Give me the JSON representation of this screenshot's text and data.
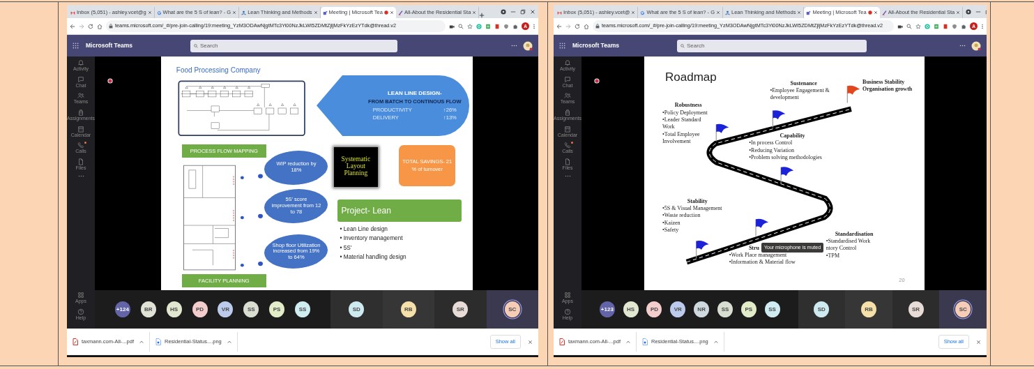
{
  "screenshots": [
    {
      "browser": {
        "tabs": [
          {
            "title": "Inbox (5,051) - ashley.vcet@g",
            "selected": false,
            "recording": false
          },
          {
            "title": "What are the 5 S of lean? - G",
            "selected": false,
            "recording": false
          },
          {
            "title": "Lean Thinking and Methods",
            "selected": false,
            "recording": false
          },
          {
            "title": "Meeting | Microsoft Tea",
            "selected": true,
            "recording": true
          },
          {
            "title": "All-About the Residential Sta",
            "selected": false,
            "recording": false
          }
        ],
        "url": "teams.microsoft.com/_#/pre-join-calling/19:meeting_YzM3ODAwNjgtMTc3Yi00NzJkLWI5ZDMtZjljMzFkYzEzYTdk@thread.v2",
        "profile_initial": "A"
      },
      "teams": {
        "app_title": "Microsoft Teams",
        "search": {
          "placeholder": "Search"
        },
        "rail": [
          {
            "label": "Activity",
            "badge": false
          },
          {
            "label": "Chat",
            "badge": false
          },
          {
            "label": "Teams",
            "badge": false
          },
          {
            "label": "Assignments",
            "badge": false
          },
          {
            "label": "Calendar",
            "badge": false
          },
          {
            "label": "Calls",
            "badge": true
          },
          {
            "label": "Files",
            "badge": false
          }
        ],
        "rail_bottom": [
          {
            "label": "Apps"
          },
          {
            "label": "Help"
          }
        ]
      },
      "slide": {
        "kind": "lean",
        "title": "Food Processing Company",
        "banners": [
          "PROCESS FLOW MAPPING",
          "FACILITY PLANNING"
        ],
        "arrow": {
          "heading": "LEAN LINE DESIGN-",
          "subheading": "FROM BATCH TO CONTINOUS FLOW",
          "metrics": [
            {
              "label": "PRODUCTIVITY",
              "value": "↑26%"
            },
            {
              "label": "DELIVERY",
              "value": "↑13%"
            }
          ]
        },
        "clouds": [
          "WIP reduction by 18%",
          "5S’ score improvement from 12 to 78",
          "Shop floor Utilization increased from 19% to 64%"
        ],
        "method_box": "Systematic Layout Planning",
        "savings": "TOTAL SAVINGS- 21 % of turnover",
        "project": {
          "title": "Project- Lean",
          "items": [
            "• Lean Line design",
            "• Inventory management",
            "• 5S’",
            "• Material handling design"
          ]
        }
      },
      "participants": [
        {
          "initials": "+124",
          "kind": "overflow",
          "color": "#6264a7",
          "speaking": false
        },
        {
          "initials": "BR",
          "kind": "avatar",
          "color": "#dfe3d6",
          "speaking": false
        },
        {
          "initials": "HS",
          "kind": "avatar",
          "color": "#e0e9cf",
          "speaking": false
        },
        {
          "initials": "PD",
          "kind": "avatar",
          "color": "#f3cccc",
          "speaking": false
        },
        {
          "initials": "VR",
          "kind": "avatar",
          "color": "#bccbec",
          "speaking": false
        },
        {
          "initials": "SS",
          "kind": "avatar",
          "color": "#d9dfd0",
          "speaking": false
        },
        {
          "initials": "PS",
          "kind": "avatar",
          "color": "#e3ecc8",
          "speaking": false
        },
        {
          "initials": "SS",
          "kind": "avatar",
          "color": "#cfecf1",
          "speaking": false
        },
        {
          "initials": "SD",
          "kind": "tile",
          "color": "#cdeaf0",
          "speaking": false
        },
        {
          "initials": "RB",
          "kind": "tile",
          "color": "#f6e0a9",
          "speaking": false
        },
        {
          "initials": "SR",
          "kind": "tile",
          "color": "#e8dcd6",
          "speaking": false
        },
        {
          "initials": "SC",
          "kind": "tile",
          "color": "#f5cdb7",
          "speaking": true
        }
      ],
      "downloads": {
        "files": [
          {
            "name": "taxmann.com-All-...pdf",
            "kind": "pdf"
          },
          {
            "name": "Residential-Status....png",
            "kind": "image"
          }
        ],
        "show_all": "Show all"
      }
    },
    {
      "browser": {
        "tabs": [
          {
            "title": "Inbox (5,051) - ashley.vcet@",
            "selected": false,
            "recording": false
          },
          {
            "title": "What are the 5 S of lean? - G",
            "selected": false,
            "recording": false
          },
          {
            "title": "Lean Thinking and Methods",
            "selected": false,
            "recording": false
          },
          {
            "title": "Meeting | Microsoft Tea",
            "selected": true,
            "recording": true
          },
          {
            "title": "All-About the Residential Sta",
            "selected": false,
            "recording": false
          }
        ],
        "url": "teams.microsoft.com/_#/pre-join-calling/19:meeting_YzM3ODAwNjgtMTc3Yi00NzJkLWI5ZDMtZjljMzFkYzEzYTdk@thread.v2",
        "profile_initial": "A"
      },
      "teams": {
        "app_title": "Microsoft Teams",
        "search": {
          "placeholder": "Search"
        },
        "rail": [
          {
            "label": "Activity",
            "badge": false
          },
          {
            "label": "Chat",
            "badge": false
          },
          {
            "label": "Teams",
            "badge": false
          },
          {
            "label": "Assignments",
            "badge": false
          },
          {
            "label": "Calendar",
            "badge": false
          },
          {
            "label": "Calls",
            "badge": true
          },
          {
            "label": "Files",
            "badge": false
          }
        ],
        "rail_bottom": [
          {
            "label": "Apps"
          },
          {
            "label": "Help"
          }
        ],
        "toast": "Your microphone is muted"
      },
      "slide": {
        "kind": "roadmap",
        "title": "Roadmap",
        "stages": [
          {
            "heading": "Robustness",
            "items": [
              "•Policy Deployment",
              "•Leader Standard Work",
              "•Total Employee Involvement"
            ]
          },
          {
            "heading": "Sustenance",
            "items": [
              "•Employee Engagement & development"
            ]
          },
          {
            "heading": "Business Stability Organisation growth"
          },
          {
            "heading": "Capability",
            "items": [
              "•In process Control",
              "•Reducing Variation",
              "•Problem solving methodologies"
            ]
          },
          {
            "heading": "Stability",
            "items": [
              "•5S & Visual Management",
              "•Waste reduction",
              "•Kaizen",
              "•Safety"
            ]
          },
          {
            "heading": "Standardisation",
            "items": [
              "•Standardised Work",
              "ntory Control",
              "•TPM"
            ]
          },
          {
            "heading": "Stru",
            "items": [
              "•Work Place management",
              "•Information & Material flow"
            ]
          }
        ],
        "page_number": "20"
      },
      "participants": [
        {
          "initials": "+123",
          "kind": "overflow",
          "color": "#6264a7",
          "speaking": false
        },
        {
          "initials": "HS",
          "kind": "avatar",
          "color": "#e0e9cf",
          "speaking": false
        },
        {
          "initials": "PD",
          "kind": "avatar",
          "color": "#f3cccc",
          "speaking": false
        },
        {
          "initials": "VR",
          "kind": "avatar",
          "color": "#bccbec",
          "speaking": false
        },
        {
          "initials": "NR",
          "kind": "avatar",
          "color": "#cdd9de",
          "speaking": false
        },
        {
          "initials": "SS",
          "kind": "avatar",
          "color": "#d9dfd0",
          "speaking": false
        },
        {
          "initials": "PS",
          "kind": "avatar",
          "color": "#e3ecc8",
          "speaking": false
        },
        {
          "initials": "SS",
          "kind": "avatar",
          "color": "#cfecf1",
          "speaking": false
        },
        {
          "initials": "SD",
          "kind": "tile",
          "color": "#cdeaf0",
          "speaking": false
        },
        {
          "initials": "RB",
          "kind": "tile",
          "color": "#f6e0a9",
          "speaking": false
        },
        {
          "initials": "SR",
          "kind": "tile",
          "color": "#e8dcd6",
          "speaking": false
        },
        {
          "initials": "SC",
          "kind": "tile",
          "color": "#f5cdb7",
          "speaking": true
        }
      ],
      "downloads": {
        "files": [
          {
            "name": "taxmann.com-All-...pdf",
            "kind": "pdf"
          },
          {
            "name": "Residential-Status....png",
            "kind": "image"
          }
        ],
        "show_all": "Show all"
      }
    }
  ]
}
